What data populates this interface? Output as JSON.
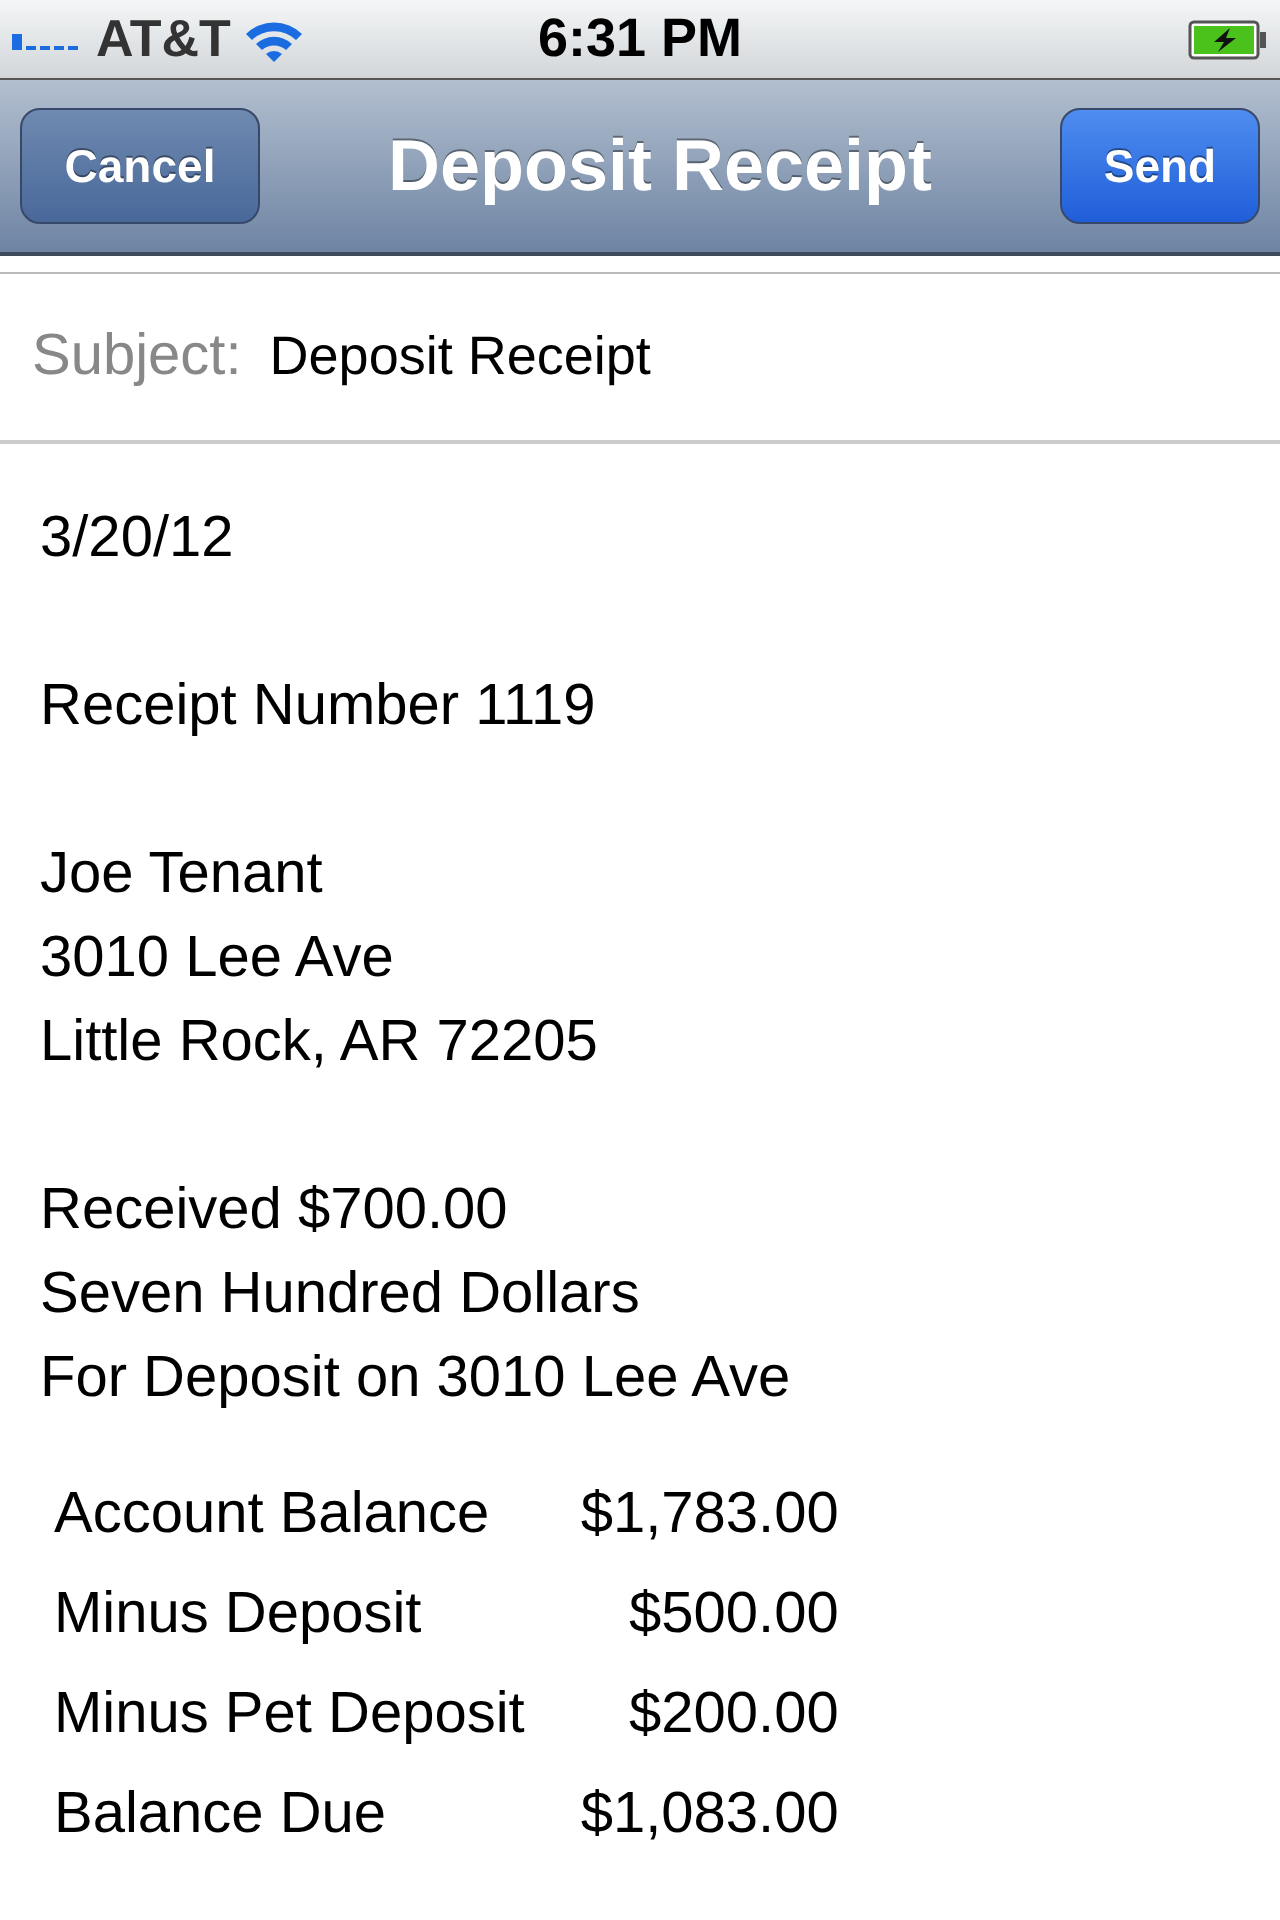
{
  "status_bar": {
    "carrier": "AT&T",
    "time": "6:31 PM"
  },
  "nav_bar": {
    "cancel": "Cancel",
    "title": "Deposit Receipt",
    "send": "Send"
  },
  "subject": {
    "label": "Subject:",
    "value": "Deposit Receipt"
  },
  "body": [
    [
      "3/20/12"
    ],
    [
      "Receipt Number 1119"
    ],
    [
      "Joe Tenant",
      "3010 Lee Ave",
      "Little Rock, AR 72205"
    ],
    [
      "Received $700.00",
      "Seven Hundred Dollars",
      "For Deposit on 3010 Lee Ave"
    ]
  ],
  "summary": [
    {
      "label": "Account Balance",
      "amount": "$1,783.00"
    },
    {
      "label": "Minus Deposit",
      "amount": "$500.00"
    },
    {
      "label": "Minus Pet Deposit",
      "amount": "$200.00"
    },
    {
      "label": "Balance Due",
      "amount": "$1,083.00"
    }
  ]
}
